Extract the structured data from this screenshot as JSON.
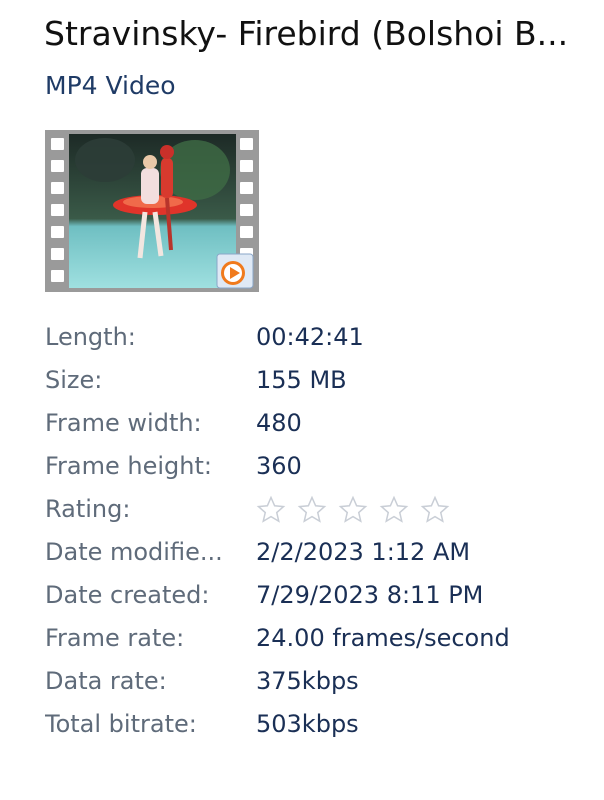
{
  "header": {
    "title": "Stravinsky- Firebird (Bolshoi B...",
    "file_type": "MP4 Video"
  },
  "thumbnail": {
    "icon": "video-film-thumbnail",
    "badge_icon": "media-player-play-icon",
    "colors": {
      "film_strip": "#9a9a9a",
      "sprocket": "#ffffff",
      "stage_floor": "#7fd1d4",
      "backdrop": "#1d2a26",
      "costume": "#e0342a",
      "badge": "#f07a1c"
    }
  },
  "properties": [
    {
      "label": "Length:",
      "value": "00:42:41"
    },
    {
      "label": "Size:",
      "value": "155 MB"
    },
    {
      "label": "Frame width:",
      "value": "480"
    },
    {
      "label": "Frame height:",
      "value": "360"
    },
    {
      "label": "Rating:",
      "value": "",
      "rating": {
        "stars": 5,
        "filled": 0
      }
    },
    {
      "label": "Date modifie...",
      "value": "2/2/2023 1:12 AM"
    },
    {
      "label": "Date created:",
      "value": "7/29/2023 8:11 PM"
    },
    {
      "label": "Frame rate:",
      "value": "24.00 frames/second"
    },
    {
      "label": "Data rate:",
      "value": "375kbps"
    },
    {
      "label": "Total bitrate:",
      "value": "503kbps"
    }
  ],
  "colors": {
    "label": "#5f6b7a",
    "value": "#1a2f55",
    "subtitle": "#1f3b66",
    "star_outline": "#c9ced6"
  }
}
